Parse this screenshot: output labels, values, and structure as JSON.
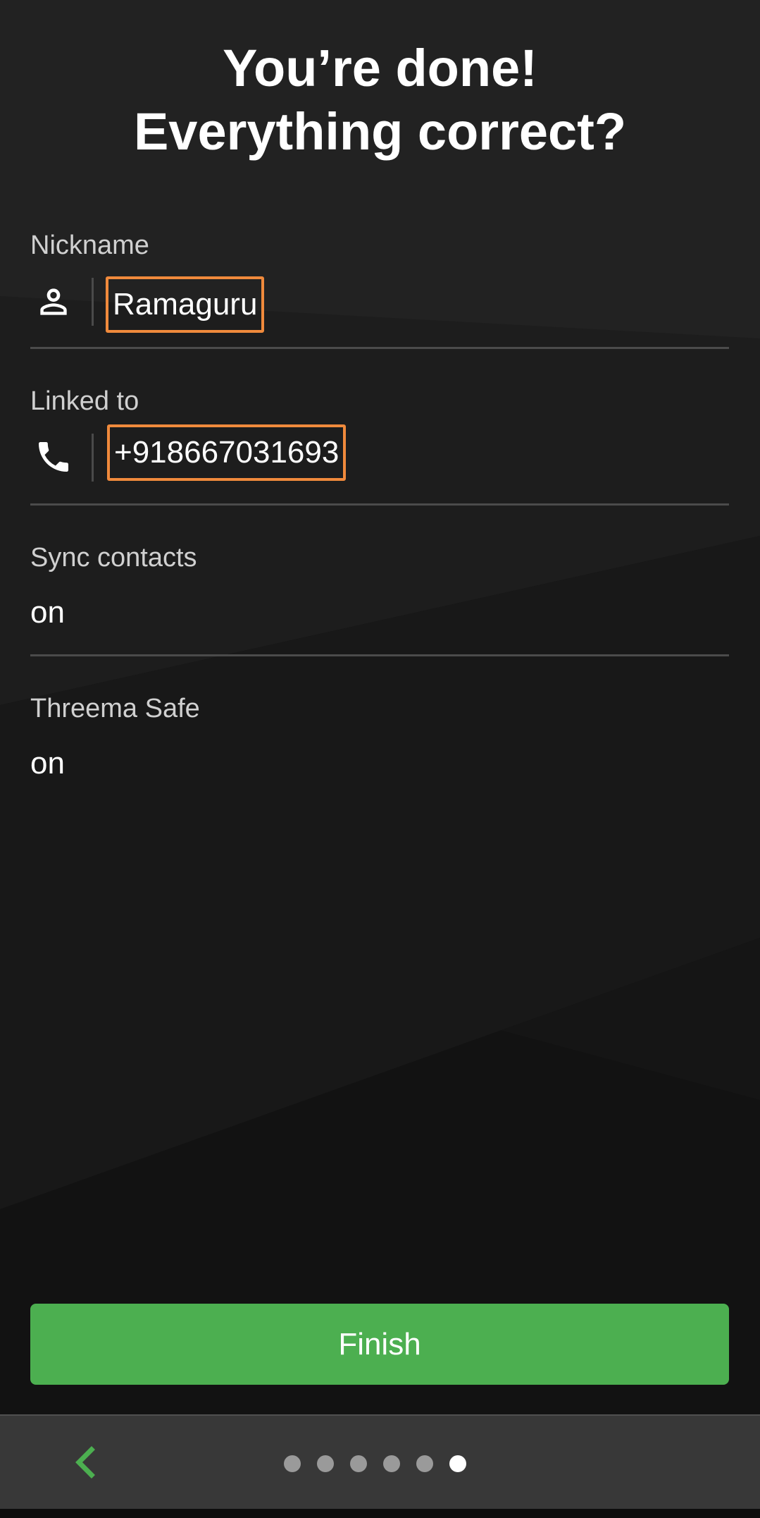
{
  "title": {
    "line1": "You’re done!",
    "line2": "Everything correct?"
  },
  "nickname": {
    "label": "Nickname",
    "icon": "person-icon",
    "value": "Ramaguru"
  },
  "linked_to": {
    "label": "Linked to",
    "icon": "phone-icon",
    "value": "+918667031693"
  },
  "sync_contacts": {
    "label": "Sync contacts",
    "value": "on"
  },
  "threema_safe": {
    "label": "Threema Safe",
    "value": "on"
  },
  "finish_button": {
    "label": "Finish"
  },
  "navigation": {
    "back_icon": "chevron-left-icon",
    "page_count": 6,
    "current_page": 6
  },
  "colors": {
    "accent": "#4caf50",
    "highlight_border": "#f08a3c",
    "background": "#1e1e1e",
    "bottom_bar": "#383838"
  }
}
